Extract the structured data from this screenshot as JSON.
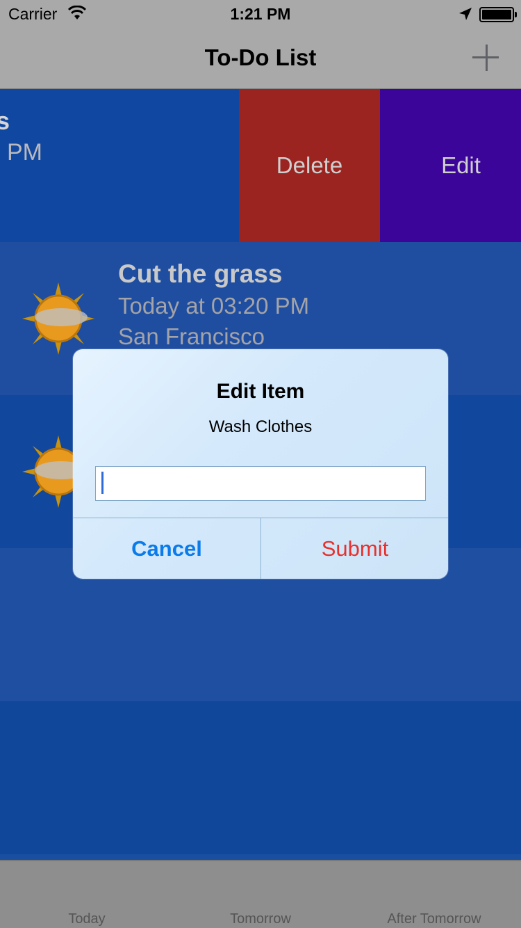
{
  "status_bar": {
    "carrier": "Carrier",
    "time": "1:21 PM"
  },
  "nav": {
    "title": "To-Do List",
    "add_icon": "plus-icon"
  },
  "rows": [
    {
      "title": "s",
      "time": "PM",
      "location": ".",
      "actions": {
        "delete": "Delete",
        "edit": "Edit"
      }
    },
    {
      "title": "Cut the grass",
      "time": "Today at 03:20 PM",
      "location": "San Francisco",
      "weather_icon": "sun-cloud-icon"
    },
    {
      "weather_icon": "sun-cloud-icon"
    }
  ],
  "alert": {
    "title": "Edit Item",
    "message": "Wash Clothes",
    "input_value": "",
    "cancel_label": "Cancel",
    "submit_label": "Submit"
  },
  "tabs": [
    {
      "label": "Today"
    },
    {
      "label": "Tomorrow"
    },
    {
      "label": "After Tomorrow"
    }
  ],
  "colors": {
    "delete_action": "#9c2420",
    "edit_action": "#3c059a",
    "cancel": "#0a7bea",
    "submit": "#e8302c"
  }
}
